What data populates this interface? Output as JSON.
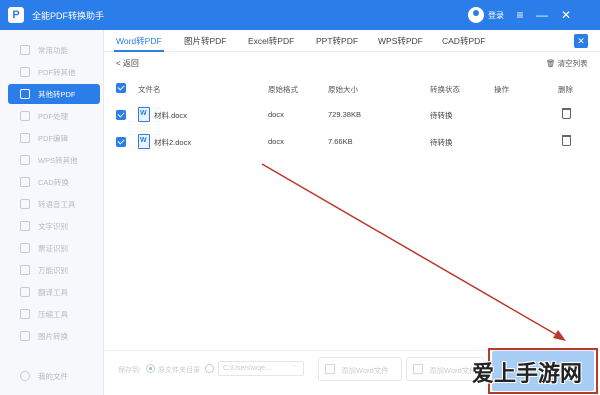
{
  "app": {
    "title": "全能PDF转换助手",
    "logo_text": "P",
    "login_label": "登录",
    "window_controls": [
      "≡",
      "—",
      "✕"
    ]
  },
  "sidebar": {
    "items": [
      {
        "label": "常用功能",
        "icon": "grid-icon"
      },
      {
        "label": "PDF转其他",
        "icon": "pdf-export-icon"
      },
      {
        "label": "其他转PDF",
        "icon": "pdf-import-icon",
        "active": true
      },
      {
        "label": "PDF处理",
        "icon": "pdf-process-icon"
      },
      {
        "label": "PDF编辑",
        "icon": "pdf-edit-icon"
      },
      {
        "label": "WPS转其他",
        "icon": "wps-icon"
      },
      {
        "label": "CAD转换",
        "icon": "cad-icon"
      },
      {
        "label": "转语音工具",
        "icon": "voice-icon"
      },
      {
        "label": "文字识别",
        "icon": "ocr-icon"
      },
      {
        "label": "票证识别",
        "icon": "ticket-icon"
      },
      {
        "label": "万能识别",
        "icon": "scan-icon"
      },
      {
        "label": "翻译工具",
        "icon": "translate-icon"
      },
      {
        "label": "压缩工具",
        "icon": "compress-icon"
      },
      {
        "label": "图片转换",
        "icon": "image-icon"
      }
    ],
    "footer_label": "我的文件"
  },
  "tabs": [
    {
      "label": "Word转PDF",
      "active": true
    },
    {
      "label": "图片转PDF"
    },
    {
      "label": "Excel转PDF"
    },
    {
      "label": "PPT转PDF"
    },
    {
      "label": "WPS转PDF"
    },
    {
      "label": "CAD转PDF"
    }
  ],
  "toolbar": {
    "back_label": "< 返回",
    "clear_label": "清空列表",
    "close_symbol": "✕"
  },
  "table": {
    "headers": {
      "name": "文件名",
      "format": "原始格式",
      "size": "原始大小",
      "status": "转换状态",
      "action": "操作",
      "delete": "删除"
    },
    "rows": [
      {
        "name": "材料.docx",
        "format": "docx",
        "size": "729.38KB",
        "status": "待转换"
      },
      {
        "name": "材料2.docx",
        "format": "docx",
        "size": "7.66KB",
        "status": "待转换"
      }
    ]
  },
  "footer": {
    "save_to_label": "保存到:",
    "option_source": "原文件夹目录",
    "path_value": "C:\\Users\\wqe...",
    "path_dots": "···",
    "add_word_label": "添加Word文件",
    "add_folder_label": "添加Word文件夹"
  },
  "watermark": "爱上手游网",
  "colors": {
    "brand": "#2b7de9",
    "annotation": "#b83a2a"
  }
}
